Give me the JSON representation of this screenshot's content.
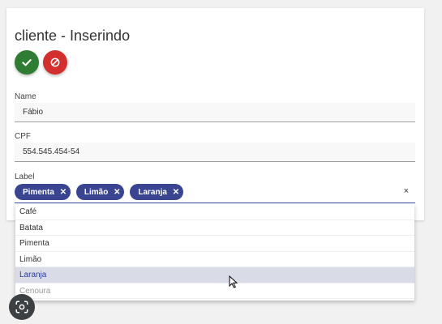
{
  "form": {
    "title": "cliente - Inserindo",
    "save_icon": "check-icon",
    "cancel_icon": "block-icon",
    "name_label": "Name",
    "name_value": "Fábio",
    "cpf_label": "CPF",
    "cpf_value": "554.545.454-54",
    "label_label": "Label",
    "clear_symbol": "×"
  },
  "chips": [
    {
      "label": "Pimenta",
      "close": "✕"
    },
    {
      "label": "Limão",
      "close": "✕"
    },
    {
      "label": "Laranja",
      "close": "✕"
    }
  ],
  "dropdown": {
    "options": [
      "Café",
      "Batata",
      "Pimenta",
      "Limão",
      "Laranja",
      "Cenoura"
    ],
    "highlighted": "Laranja"
  },
  "colors": {
    "save": "#2e7d32",
    "cancel": "#d32f2f",
    "chip": "#3a4592",
    "highlight": "#d9dbe6"
  }
}
